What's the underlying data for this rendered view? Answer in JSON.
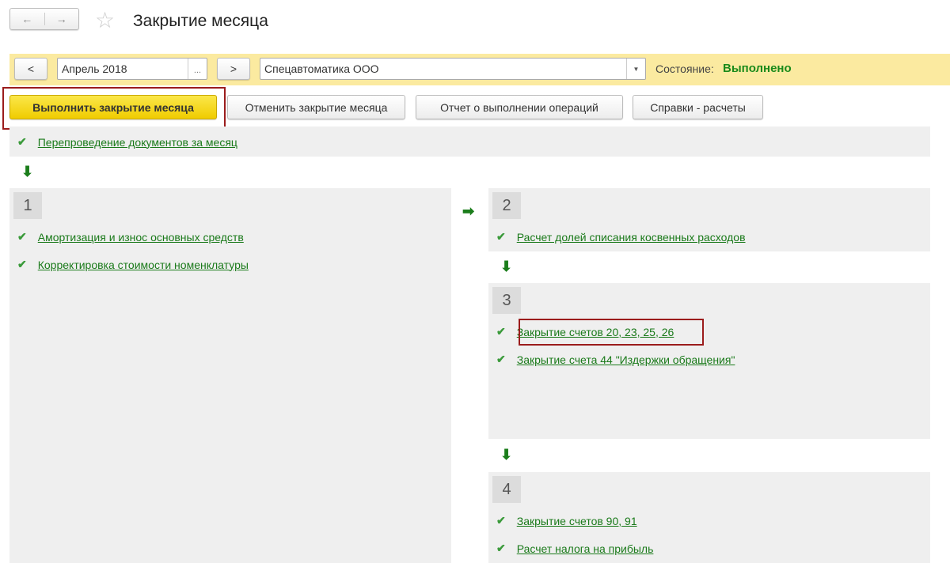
{
  "header": {
    "title": "Закрытие месяца",
    "back_icon": "←",
    "forward_icon": "→",
    "star_icon": "☆"
  },
  "toolbar": {
    "prev": "<",
    "period": "Апрель 2018",
    "period_select": "...",
    "next": ">",
    "organization": "Спецавтоматика ООО",
    "state_label": "Состояние:",
    "state_value": "Выполнено"
  },
  "actions": {
    "run": "Выполнить закрытие месяца",
    "cancel": "Отменить закрытие месяца",
    "report": "Отчет о выполнении операций",
    "refs": "Справки - расчеты"
  },
  "pre": {
    "check": "✔",
    "label": "Перепроведение документов за месяц"
  },
  "steps": [
    {
      "number": "1",
      "items": [
        "Амортизация и износ основных средств",
        "Корректировка стоимости номенклатуры"
      ]
    },
    {
      "number": "2",
      "items": [
        "Расчет долей списания косвенных расходов"
      ]
    },
    {
      "number": "3",
      "items": [
        "Закрытие счетов 20, 23, 25, 26",
        "Закрытие счета 44 \"Издержки обращения\""
      ]
    },
    {
      "number": "4",
      "items": [
        "Закрытие счетов 90, 91",
        "Расчет налога на прибыль"
      ]
    }
  ],
  "colors": {
    "accent_yellow": "#f5d80c",
    "band": "#fbeaa0",
    "link_green": "#1a7a1a",
    "status_green": "#1a8a1a",
    "highlight": "#9b1c1c"
  }
}
